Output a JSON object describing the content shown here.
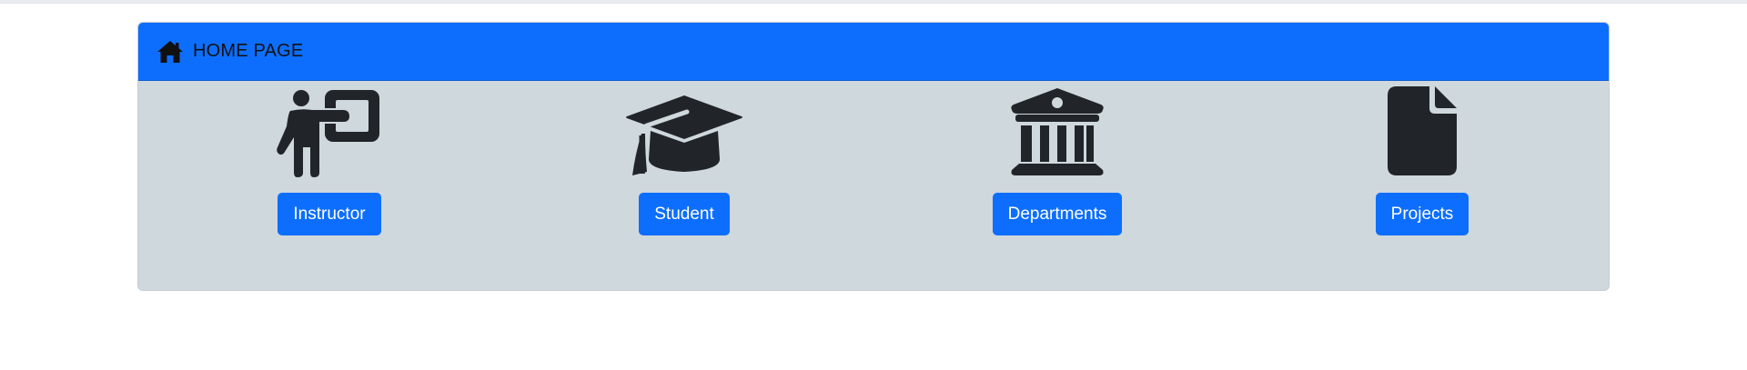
{
  "header": {
    "title": "HOME PAGE",
    "icon": "home-icon"
  },
  "tiles": [
    {
      "label": "Instructor",
      "icon": "instructor-icon"
    },
    {
      "label": "Student",
      "icon": "graduation-cap-icon"
    },
    {
      "label": "Departments",
      "icon": "building-columns-icon"
    },
    {
      "label": "Projects",
      "icon": "file-icon"
    }
  ],
  "colors": {
    "primary": "#0d6efd",
    "card_body": "#cfd8dd",
    "icon_dark": "#212529"
  }
}
